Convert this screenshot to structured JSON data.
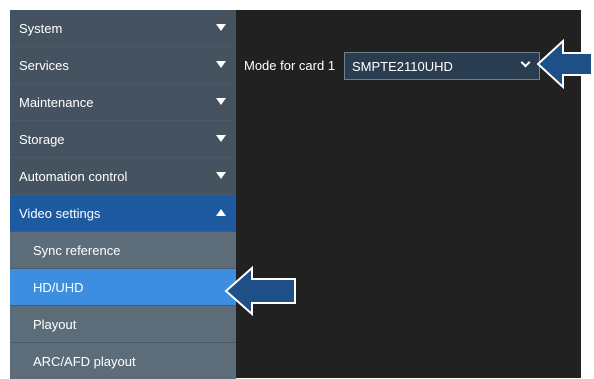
{
  "sidebar": {
    "items": [
      {
        "label": "System"
      },
      {
        "label": "Services"
      },
      {
        "label": "Maintenance"
      },
      {
        "label": "Storage"
      },
      {
        "label": "Automation control"
      },
      {
        "label": "Video settings"
      }
    ],
    "subitems": [
      {
        "label": "Sync reference"
      },
      {
        "label": "HD/UHD"
      },
      {
        "label": "Playout"
      },
      {
        "label": "ARC/AFD playout"
      }
    ]
  },
  "main": {
    "mode_label": "Mode for card 1",
    "mode_value": "SMPTE2110UHD"
  },
  "colors": {
    "sidebar_item": "#44535f",
    "sidebar_expanded": "#1e5aa0",
    "sidebar_subitem": "#5c6c78",
    "sidebar_active": "#3b8ee0",
    "content_bg": "#212121",
    "callout_arrow": "#1e4f86"
  }
}
